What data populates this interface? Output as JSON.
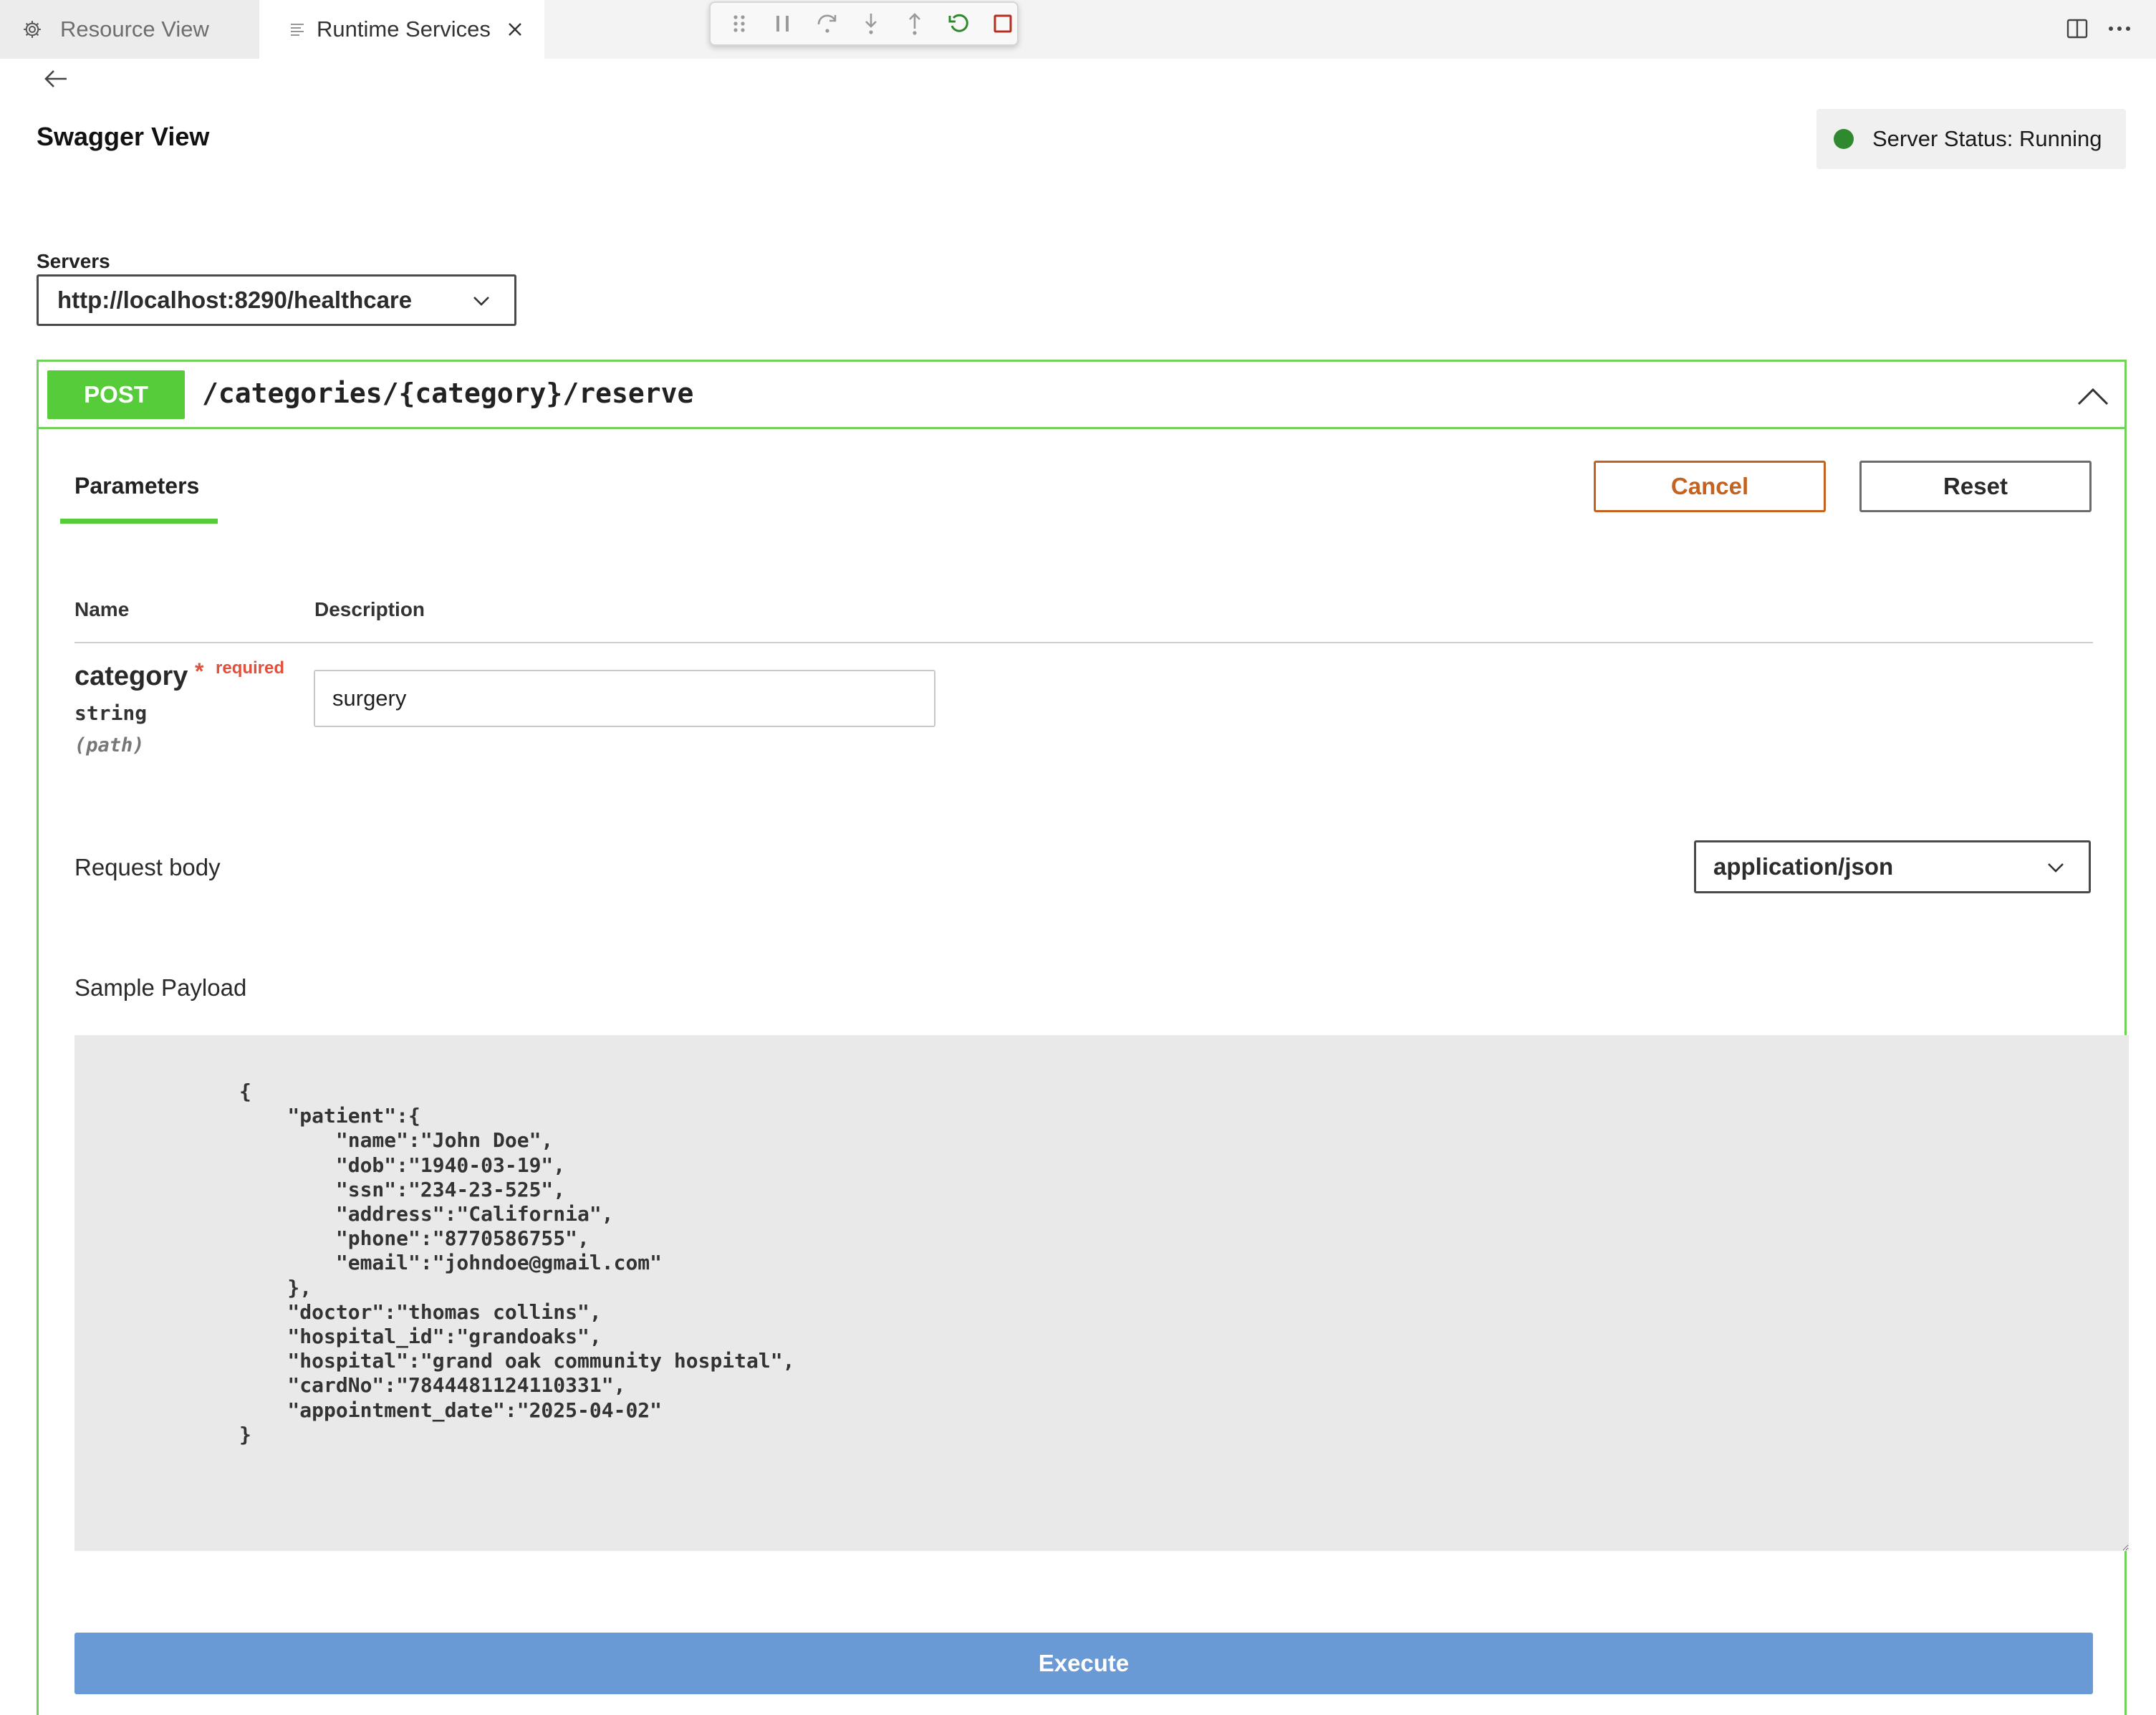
{
  "tabs": [
    {
      "label": "Resource View",
      "icon": "gear-icon",
      "active": false
    },
    {
      "label": "Runtime Services",
      "icon": "list-icon",
      "active": true
    }
  ],
  "debug_toolbar": [
    "drag-handle-icon",
    "pause-icon",
    "step-over-icon",
    "step-into-icon",
    "step-out-icon",
    "restart-icon",
    "stop-icon"
  ],
  "header": {
    "title": "Swagger View",
    "status": "Server Status: Running",
    "status_color": "#2f8a2f"
  },
  "servers": {
    "label": "Servers",
    "selected": "http://localhost:8290/healthcare"
  },
  "operation": {
    "method": "POST",
    "path": "/categories/{category}/reserve",
    "method_color": "#57cc3a",
    "tab_label": "Parameters",
    "cancel_label": "Cancel",
    "reset_label": "Reset",
    "columns": {
      "name": "Name",
      "description": "Description"
    },
    "parameter": {
      "name": "category",
      "star": "*",
      "required_label": "required",
      "type": "string",
      "in": "(path)",
      "value": "surgery"
    },
    "request_body_label": "Request body",
    "content_type": "application/json",
    "sample_payload_label": "Sample Payload",
    "sample_payload": "{\n    \"patient\":{\n        \"name\":\"John Doe\",\n        \"dob\":\"1940-03-19\",\n        \"ssn\":\"234-23-525\",\n        \"address\":\"California\",\n        \"phone\":\"8770586755\",\n        \"email\":\"johndoe@gmail.com\"\n    },\n    \"doctor\":\"thomas collins\",\n    \"hospital_id\":\"grandoaks\",\n    \"hospital\":\"grand oak community hospital\",\n    \"cardNo\":\"7844481124110331\",\n    \"appointment_date\":\"2025-04-02\"\n}",
    "execute_label": "Execute",
    "execute_color": "#6a9ad6"
  }
}
